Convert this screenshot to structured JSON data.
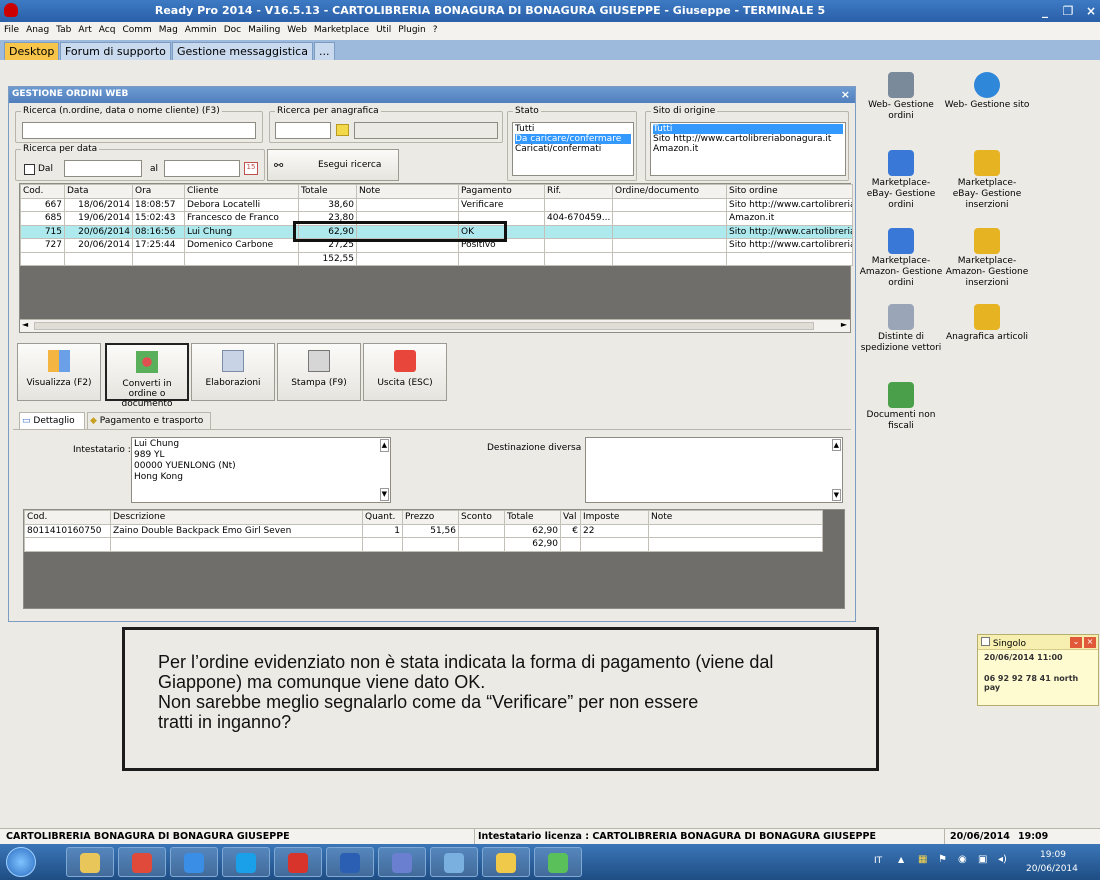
{
  "window": {
    "title": "Ready Pro 2014 - V16.5.13 - CARTOLIBRERIA BONAGURA DI BONAGURA GIUSEPPE - Giuseppe - TERMINALE 5",
    "min": "_",
    "max": "❐",
    "close": "×"
  },
  "menu": [
    "File",
    "Anag",
    "Tab",
    "Art",
    "Acq",
    "Comm",
    "Mag",
    "Ammin",
    "Doc",
    "Mailing",
    "Web",
    "Marketplace",
    "Util",
    "Plugin",
    "?"
  ],
  "tabs": [
    "Desktop",
    "Forum di supporto",
    "Gestione messaggistica",
    "..."
  ],
  "desktop_icons": [
    {
      "label": "Web- Gestione ordini",
      "icon": "cart-icon",
      "color": "#7a8a9a"
    },
    {
      "label": "Web- Gestione sito",
      "icon": "globe-icon",
      "color": "#2f87d9"
    },
    {
      "label": "Marketplace- eBay- Gestione ordini",
      "icon": "cubes-icon",
      "color": "#3a78d8"
    },
    {
      "label": "Marketplace- eBay- Gestione inserzioni",
      "icon": "box-icon",
      "color": "#e6b422"
    },
    {
      "label": "Marketplace- Amazon- Gestione ordini",
      "icon": "cubes-icon",
      "color": "#3a78d8"
    },
    {
      "label": "Marketplace- Amazon- Gestione inserzioni",
      "icon": "box-icon",
      "color": "#e6b422"
    },
    {
      "label": "Distinte di spedizione vettori",
      "icon": "scroll-icon",
      "color": "#9aa6b8"
    },
    {
      "label": "Anagrafica articoli",
      "icon": "boxes-icon",
      "color": "#e6b422"
    },
    {
      "label": "Documenti non fiscali",
      "icon": "document-icon",
      "color": "#4aa04a"
    }
  ],
  "panel": {
    "title": "GESTIONE ORDINI WEB",
    "close": "×",
    "search": {
      "label": "Ricerca (n.ordine, data o nome cliente) (F3)",
      "value": ""
    },
    "search_registry": {
      "label": "Ricerca per anagrafica"
    },
    "date_search": {
      "label": "Ricerca per data",
      "from_label": "Dal",
      "to_label": "al",
      "calendar": "15"
    },
    "run_search": "Esegui ricerca",
    "stato": {
      "label": "Stato",
      "options": [
        "Tutti",
        "Da caricare/confermare",
        "Caricati/confermati"
      ],
      "selected": 1
    },
    "origin": {
      "label": "Sito di origine",
      "options": [
        "Tutti",
        "Sito http://www.cartolibreriabonagura.it",
        "Amazon.it"
      ],
      "selected": 0
    },
    "orders": {
      "columns": [
        "Cod.",
        "Data",
        "Ora",
        "Cliente",
        "Totale",
        "Note",
        "Pagamento",
        "Rif.",
        "Ordine/documento",
        "Sito ordine"
      ],
      "rows": [
        [
          "667",
          "18/06/2014",
          "18:08:57",
          "Debora Locatelli",
          "38,60",
          "",
          "Verificare",
          "",
          "",
          "Sito http://www.cartolibreriab"
        ],
        [
          "685",
          "19/06/2014",
          "15:02:43",
          "Francesco de Franco",
          "23,80",
          "",
          "",
          "404-670459...",
          "",
          "Amazon.it"
        ],
        [
          "715",
          "20/06/2014",
          "08:16:56",
          "Lui Chung",
          "62,90",
          "",
          "OK",
          "",
          "",
          "Sito http://www.cartolibreriab"
        ],
        [
          "727",
          "20/06/2014",
          "17:25:44",
          "Domenico Carbone",
          "27,25",
          "",
          "Positivo",
          "",
          "",
          "Sito http://www.cartolibreriab"
        ]
      ],
      "total": "152,55",
      "highlight_row": 2
    },
    "toolbar": [
      {
        "label": "Visualizza (F2)",
        "icon": "grid-check-icon"
      },
      {
        "label": "Converti in ordine o documento",
        "icon": "shapes-icon"
      },
      {
        "label": "Elaborazioni",
        "icon": "gear-document-icon"
      },
      {
        "label": "Stampa (F9)",
        "icon": "printer-icon"
      },
      {
        "label": "Uscita (ESC)",
        "icon": "power-icon"
      }
    ],
    "detail_tabs": [
      "Dettaglio",
      "Pagamento e trasporto"
    ],
    "intestatario": {
      "label": "Intestatario :",
      "lines": [
        "Lui Chung",
        "989 YL",
        "00000 YUENLONG (Nt)",
        "Hong Kong"
      ]
    },
    "destinazione": {
      "label": "Destinazione diversa :"
    },
    "items": {
      "columns": [
        "Cod.",
        "Descrizione",
        "Quant.",
        "Prezzo",
        "Sconto",
        "Totale",
        "Val",
        "Imposte",
        "Note"
      ],
      "rows": [
        [
          "8011410160750",
          "Zaino Double Backpack Emo Girl Seven",
          "1",
          "51,56",
          "",
          "62,90",
          "€",
          "22",
          ""
        ]
      ],
      "total": "62,90"
    }
  },
  "note": [
    "Per l’ordine evidenziato non è stata indicata la forma di pagamento (viene dal",
    "Giappone) ma comunque viene dato OK.",
    "Non sarebbe meglio segnalarlo come da “Verificare” per non essere",
    "tratti in inganno?"
  ],
  "reminder": {
    "title": "Singolo",
    "datetime": "20/06/2014  11:00",
    "text": "06 92 92 78 41 north pay"
  },
  "status": {
    "company": "CARTOLIBRERIA BONAGURA DI BONAGURA GIUSEPPE",
    "license": "Intestatario licenza : CARTOLIBRERIA BONAGURA DI BONAGURA GIUSEPPE",
    "date": "20/06/2014",
    "time": "19:09"
  },
  "taskbar": {
    "lang": "IT",
    "clock_time": "19:09",
    "clock_date": "20/06/2014",
    "apps": [
      {
        "name": "explorer",
        "color": "#e8c65a"
      },
      {
        "name": "chrome",
        "color": "#e04a3a"
      },
      {
        "name": "ie",
        "color": "#3a8ee6"
      },
      {
        "name": "skype",
        "color": "#1aa0e8"
      },
      {
        "name": "readypro",
        "color": "#d8342c"
      },
      {
        "name": "word",
        "color": "#2b5fb4"
      },
      {
        "name": "app",
        "color": "#6a7fd0"
      },
      {
        "name": "camera",
        "color": "#7ab0e0"
      },
      {
        "name": "folder",
        "color": "#f0c84a"
      },
      {
        "name": "green-app",
        "color": "#5ac05a"
      }
    ]
  }
}
